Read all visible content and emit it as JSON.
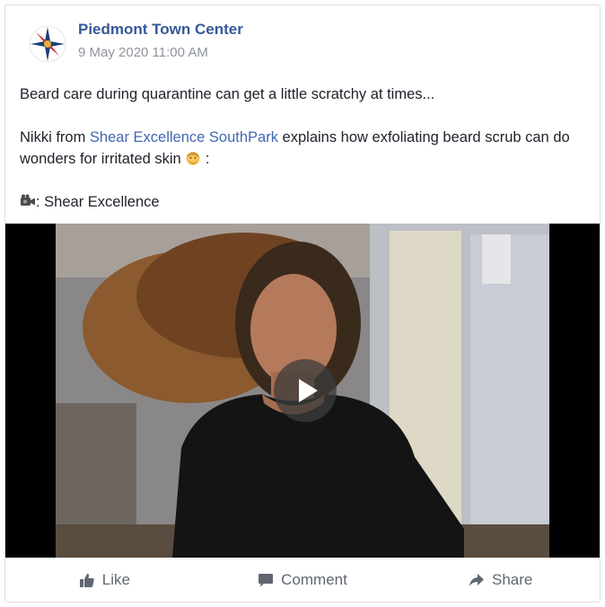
{
  "post": {
    "page_name": "Piedmont Town Center",
    "timestamp": "9 May 2020 11:00 AM",
    "line1": "Beard care during quarantine can get a little scratchy at times...",
    "line2_prefix": "Nikki from ",
    "line2_link": "Shear Excellence SouthPark",
    "line2_suffix": " explains how exfoliating beard scrub can do wonders for irritated skin ",
    "line2_end": " :",
    "credit": ": Shear Excellence"
  },
  "icons": {
    "avatar": "compass-rose-logo",
    "emoji": "man-with-beard-emoji",
    "credit": "video-camera-icon",
    "play": "play-icon",
    "like": "thumbs-up-icon",
    "comment": "speech-bubble-icon",
    "share": "share-arrow-icon"
  },
  "actions": {
    "like": "Like",
    "comment": "Comment",
    "share": "Share"
  },
  "colors": {
    "page_name": "#365899",
    "link": "#4267b2",
    "text": "#1d2129",
    "muted": "#90949c",
    "action": "#606770"
  }
}
